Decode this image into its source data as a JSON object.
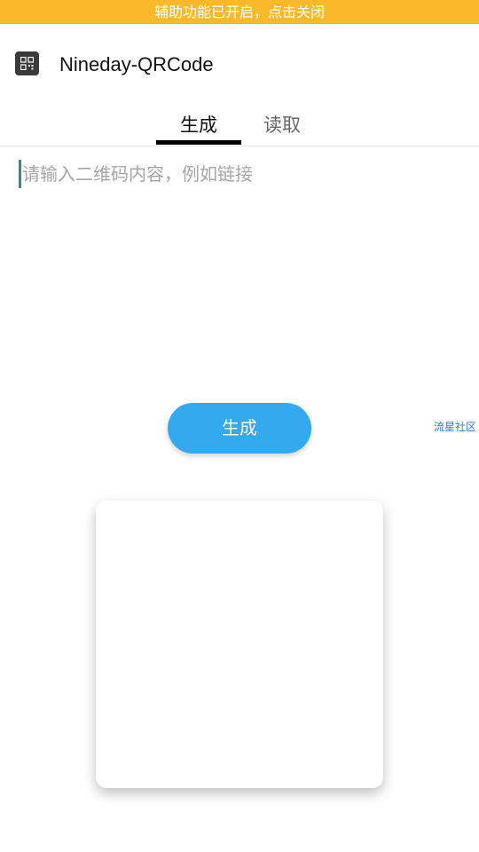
{
  "status_banner": {
    "text": "辅助功能已开启，点击关闭",
    "color": "#FBB829"
  },
  "app_bar": {
    "title": "Nineday-QRCode",
    "icon": "qr-code-icon"
  },
  "tabs": [
    {
      "label": "生成",
      "selected": true
    },
    {
      "label": "读取",
      "selected": false
    }
  ],
  "input": {
    "placeholder": "请输入二维码内容，例如链接",
    "value": ""
  },
  "generate_button": {
    "label": "生成",
    "color": "#33A9EE"
  },
  "side_link": {
    "text": "流星社区"
  },
  "qr_output": {
    "state": "empty"
  }
}
